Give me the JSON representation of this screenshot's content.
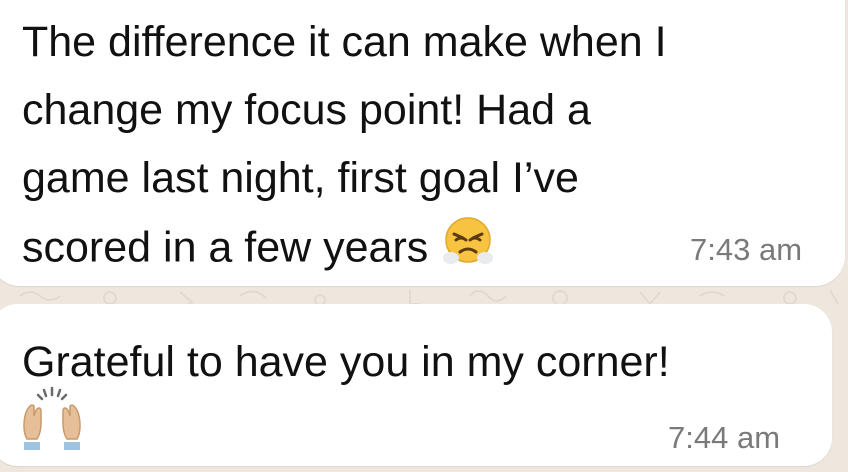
{
  "messages": [
    {
      "text_lines": [
        "The difference it can make when I",
        "change my focus point! Had a",
        "game last night, first goal I’ve",
        "scored in a few years"
      ],
      "emoji": "face-with-steam-from-nose",
      "time": "7:43 am"
    },
    {
      "text": "Grateful to have you in my corner!",
      "emoji": "raising-hands",
      "time": "7:44 am"
    }
  ],
  "colors": {
    "chat_background": "#efe7de",
    "bubble": "#ffffff",
    "text": "#111111",
    "timestamp": "#7a7a7a"
  }
}
